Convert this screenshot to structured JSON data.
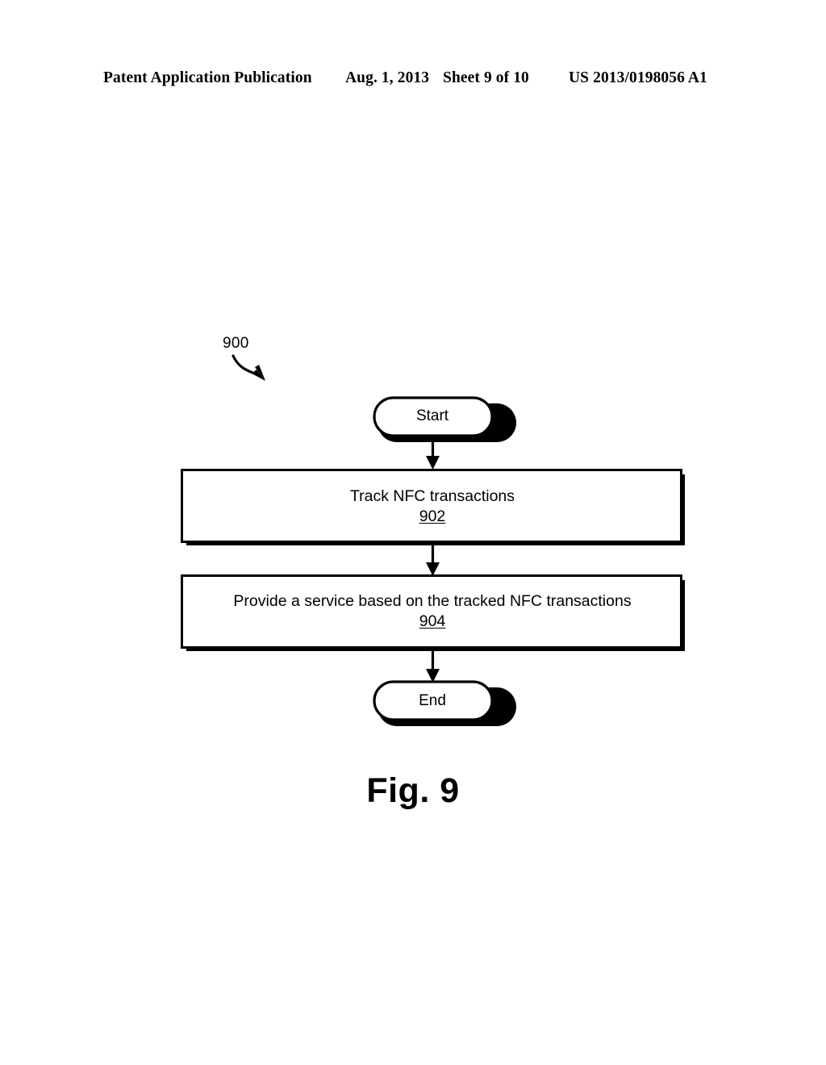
{
  "header": {
    "publication": "Patent Application Publication",
    "date": "Aug. 1, 2013",
    "sheet": "Sheet 9 of 10",
    "patent_number": "US 2013/0198056 A1"
  },
  "figure": {
    "reference_numeral": "900",
    "caption": "Fig. 9",
    "nodes": [
      {
        "id": "start",
        "type": "terminal",
        "label": "Start"
      },
      {
        "id": "step-902",
        "type": "process",
        "label": "Track NFC transactions",
        "number": "902"
      },
      {
        "id": "step-904",
        "type": "process",
        "label": "Provide a service based on the tracked NFC transactions",
        "number": "904"
      },
      {
        "id": "end",
        "type": "terminal",
        "label": "End"
      }
    ],
    "connectors": [
      {
        "from": "start",
        "to": "step-902",
        "kind": "arrow-down"
      },
      {
        "from": "step-902",
        "to": "step-904",
        "kind": "arrow-down"
      },
      {
        "from": "step-904",
        "to": "end",
        "kind": "arrow-down"
      },
      {
        "from": "reference-numeral",
        "to": "flowchart",
        "kind": "curved-arrow"
      }
    ]
  },
  "colors": {
    "ink": "#000000",
    "paper": "#ffffff",
    "shadow": "#000000"
  }
}
